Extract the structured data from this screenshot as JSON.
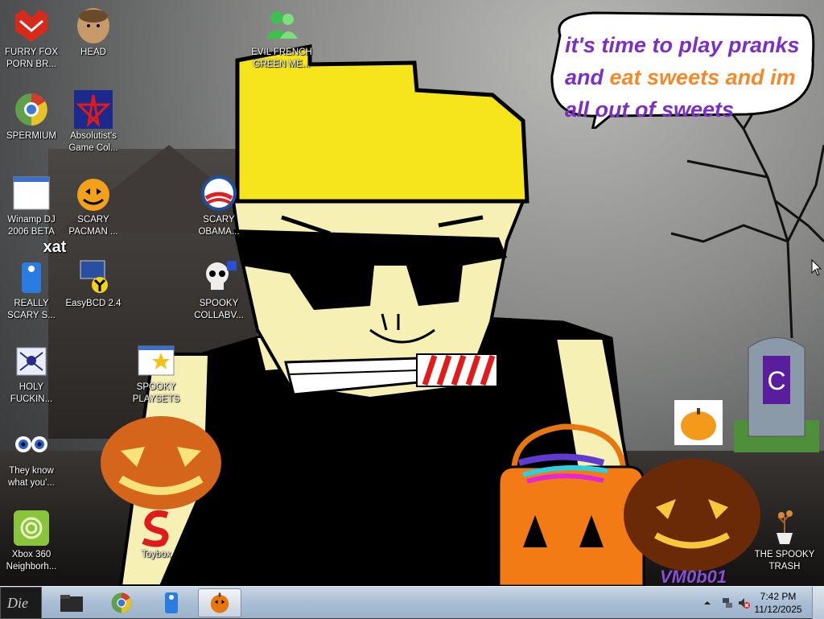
{
  "desktop": {
    "icons": [
      {
        "id": "furry-fox",
        "label": "FURRY FOX PORN BR..."
      },
      {
        "id": "head",
        "label": "HEAD"
      },
      {
        "id": "evil-french",
        "label": "EVIL FRENCH GREEN ME..."
      },
      {
        "id": "spermium",
        "label": "SPERMIUM"
      },
      {
        "id": "absolutist",
        "label": "Absolutist's Game Col..."
      },
      {
        "id": "winamp",
        "label": "Winamp DJ 2006 BETA"
      },
      {
        "id": "scary-pacman",
        "label": "SCARY PACMAN ..."
      },
      {
        "id": "scary-obama",
        "label": "SCARY OBAMA..."
      },
      {
        "id": "really-scary",
        "label": "REALLY SCARY S..."
      },
      {
        "id": "easybcd",
        "label": "EasyBCD 2.4"
      },
      {
        "id": "spooky-collab",
        "label": "SPOOKY COLLABV..."
      },
      {
        "id": "holy",
        "label": "HOLY FUCKIN..."
      },
      {
        "id": "spooky-playsets",
        "label": "SPOOKY PLAYSETS"
      },
      {
        "id": "they-know",
        "label": "They know what you'..."
      },
      {
        "id": "xbox",
        "label": "Xbox 360 Neighborh..."
      },
      {
        "id": "toybox",
        "label": "Toybox"
      },
      {
        "id": "spooky-trash",
        "label": "THE SPOOKY TRASH"
      }
    ],
    "badge_xat": "xat",
    "speech_bubble": {
      "line1": "it's time to play pranks",
      "line2a": "and ",
      "line2b": "eat sweets and im",
      "line3": "all out of sweets"
    },
    "watermark": "VM0b01",
    "colors": {
      "purple": "#7b2fc4",
      "orange": "#f38a2a",
      "yellow": "#f5e51a"
    }
  },
  "taskbar": {
    "start_label": "Die",
    "apps": [
      "folder-icon",
      "chrome-icon",
      "xat-icon",
      "pumpkin-icon"
    ],
    "clock": {
      "time": "7:42 PM",
      "date": "11/12/2025"
    }
  }
}
